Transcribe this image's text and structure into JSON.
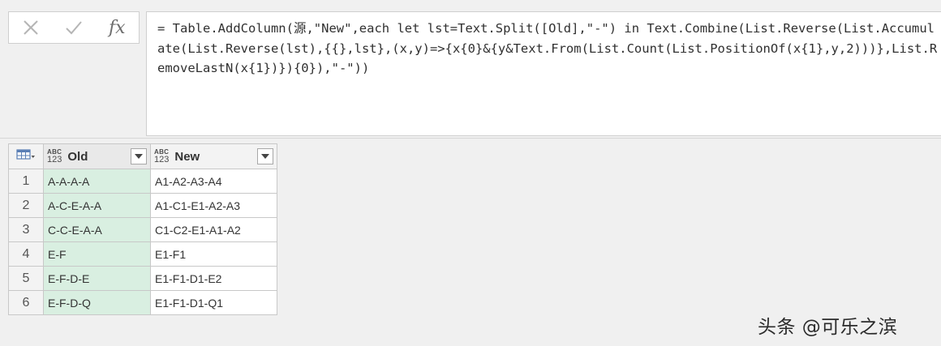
{
  "formula_bar": {
    "cancel_icon": "close-icon",
    "confirm_icon": "check-icon",
    "fx_label": "fx",
    "formula": "= Table.AddColumn(源,\"New\",each let lst=Text.Split([Old],\"-\") in Text.Combine(List.Reverse(List.Accumulate(List.Reverse(lst),{{},lst},(x,y)=>{x{0}&{y&Text.From(List.Count(List.PositionOf(x{1},y,2)))},List.RemoveLastN(x{1})}){0}),\"-\"))"
  },
  "grid": {
    "corner_icon": "table-menu-icon",
    "columns": [
      {
        "type_top": "ABC",
        "type_bottom": "123",
        "label": "Old"
      },
      {
        "type_top": "ABC",
        "type_bottom": "123",
        "label": "New"
      }
    ],
    "rows": [
      {
        "num": "1",
        "old": "A-A-A-A",
        "new": "A1-A2-A3-A4"
      },
      {
        "num": "2",
        "old": "A-C-E-A-A",
        "new": "A1-C1-E1-A2-A3"
      },
      {
        "num": "3",
        "old": "C-C-E-A-A",
        "new": "C1-C2-E1-A1-A2"
      },
      {
        "num": "4",
        "old": "E-F",
        "new": "E1-F1"
      },
      {
        "num": "5",
        "old": "E-F-D-E",
        "new": "E1-F1-D1-E2"
      },
      {
        "num": "6",
        "old": "E-F-D-Q",
        "new": "E1-F1-D1-Q1"
      }
    ]
  },
  "watermark": "头条 @可乐之滨",
  "colors": {
    "selected_column_bg": "#d9efe1",
    "header_bg": "#f3f3f3",
    "grid_border": "#c8c8c8",
    "page_bg": "#f0f0f0"
  }
}
